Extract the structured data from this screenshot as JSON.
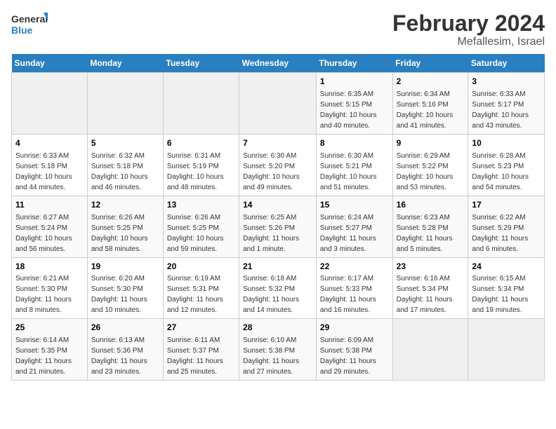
{
  "logo": {
    "line1": "General",
    "line2": "Blue"
  },
  "header": {
    "month": "February 2024",
    "location": "Mefallesim, Israel"
  },
  "days_of_week": [
    "Sunday",
    "Monday",
    "Tuesday",
    "Wednesday",
    "Thursday",
    "Friday",
    "Saturday"
  ],
  "weeks": [
    [
      {
        "day": "",
        "sunrise": "",
        "sunset": "",
        "daylight": ""
      },
      {
        "day": "",
        "sunrise": "",
        "sunset": "",
        "daylight": ""
      },
      {
        "day": "",
        "sunrise": "",
        "sunset": "",
        "daylight": ""
      },
      {
        "day": "",
        "sunrise": "",
        "sunset": "",
        "daylight": ""
      },
      {
        "day": "1",
        "sunrise": "Sunrise: 6:35 AM",
        "sunset": "Sunset: 5:15 PM",
        "daylight": "Daylight: 10 hours and 40 minutes."
      },
      {
        "day": "2",
        "sunrise": "Sunrise: 6:34 AM",
        "sunset": "Sunset: 5:16 PM",
        "daylight": "Daylight: 10 hours and 41 minutes."
      },
      {
        "day": "3",
        "sunrise": "Sunrise: 6:33 AM",
        "sunset": "Sunset: 5:17 PM",
        "daylight": "Daylight: 10 hours and 43 minutes."
      }
    ],
    [
      {
        "day": "4",
        "sunrise": "Sunrise: 6:33 AM",
        "sunset": "Sunset: 5:18 PM",
        "daylight": "Daylight: 10 hours and 44 minutes."
      },
      {
        "day": "5",
        "sunrise": "Sunrise: 6:32 AM",
        "sunset": "Sunset: 5:18 PM",
        "daylight": "Daylight: 10 hours and 46 minutes."
      },
      {
        "day": "6",
        "sunrise": "Sunrise: 6:31 AM",
        "sunset": "Sunset: 5:19 PM",
        "daylight": "Daylight: 10 hours and 48 minutes."
      },
      {
        "day": "7",
        "sunrise": "Sunrise: 6:30 AM",
        "sunset": "Sunset: 5:20 PM",
        "daylight": "Daylight: 10 hours and 49 minutes."
      },
      {
        "day": "8",
        "sunrise": "Sunrise: 6:30 AM",
        "sunset": "Sunset: 5:21 PM",
        "daylight": "Daylight: 10 hours and 51 minutes."
      },
      {
        "day": "9",
        "sunrise": "Sunrise: 6:29 AM",
        "sunset": "Sunset: 5:22 PM",
        "daylight": "Daylight: 10 hours and 53 minutes."
      },
      {
        "day": "10",
        "sunrise": "Sunrise: 6:28 AM",
        "sunset": "Sunset: 5:23 PM",
        "daylight": "Daylight: 10 hours and 54 minutes."
      }
    ],
    [
      {
        "day": "11",
        "sunrise": "Sunrise: 6:27 AM",
        "sunset": "Sunset: 5:24 PM",
        "daylight": "Daylight: 10 hours and 56 minutes."
      },
      {
        "day": "12",
        "sunrise": "Sunrise: 6:26 AM",
        "sunset": "Sunset: 5:25 PM",
        "daylight": "Daylight: 10 hours and 58 minutes."
      },
      {
        "day": "13",
        "sunrise": "Sunrise: 6:26 AM",
        "sunset": "Sunset: 5:25 PM",
        "daylight": "Daylight: 10 hours and 59 minutes."
      },
      {
        "day": "14",
        "sunrise": "Sunrise: 6:25 AM",
        "sunset": "Sunset: 5:26 PM",
        "daylight": "Daylight: 11 hours and 1 minute."
      },
      {
        "day": "15",
        "sunrise": "Sunrise: 6:24 AM",
        "sunset": "Sunset: 5:27 PM",
        "daylight": "Daylight: 11 hours and 3 minutes."
      },
      {
        "day": "16",
        "sunrise": "Sunrise: 6:23 AM",
        "sunset": "Sunset: 5:28 PM",
        "daylight": "Daylight: 11 hours and 5 minutes."
      },
      {
        "day": "17",
        "sunrise": "Sunrise: 6:22 AM",
        "sunset": "Sunset: 5:29 PM",
        "daylight": "Daylight: 11 hours and 6 minutes."
      }
    ],
    [
      {
        "day": "18",
        "sunrise": "Sunrise: 6:21 AM",
        "sunset": "Sunset: 5:30 PM",
        "daylight": "Daylight: 11 hours and 8 minutes."
      },
      {
        "day": "19",
        "sunrise": "Sunrise: 6:20 AM",
        "sunset": "Sunset: 5:30 PM",
        "daylight": "Daylight: 11 hours and 10 minutes."
      },
      {
        "day": "20",
        "sunrise": "Sunrise: 6:19 AM",
        "sunset": "Sunset: 5:31 PM",
        "daylight": "Daylight: 11 hours and 12 minutes."
      },
      {
        "day": "21",
        "sunrise": "Sunrise: 6:18 AM",
        "sunset": "Sunset: 5:32 PM",
        "daylight": "Daylight: 11 hours and 14 minutes."
      },
      {
        "day": "22",
        "sunrise": "Sunrise: 6:17 AM",
        "sunset": "Sunset: 5:33 PM",
        "daylight": "Daylight: 11 hours and 16 minutes."
      },
      {
        "day": "23",
        "sunrise": "Sunrise: 6:16 AM",
        "sunset": "Sunset: 5:34 PM",
        "daylight": "Daylight: 11 hours and 17 minutes."
      },
      {
        "day": "24",
        "sunrise": "Sunrise: 6:15 AM",
        "sunset": "Sunset: 5:34 PM",
        "daylight": "Daylight: 11 hours and 19 minutes."
      }
    ],
    [
      {
        "day": "25",
        "sunrise": "Sunrise: 6:14 AM",
        "sunset": "Sunset: 5:35 PM",
        "daylight": "Daylight: 11 hours and 21 minutes."
      },
      {
        "day": "26",
        "sunrise": "Sunrise: 6:13 AM",
        "sunset": "Sunset: 5:36 PM",
        "daylight": "Daylight: 11 hours and 23 minutes."
      },
      {
        "day": "27",
        "sunrise": "Sunrise: 6:11 AM",
        "sunset": "Sunset: 5:37 PM",
        "daylight": "Daylight: 11 hours and 25 minutes."
      },
      {
        "day": "28",
        "sunrise": "Sunrise: 6:10 AM",
        "sunset": "Sunset: 5:38 PM",
        "daylight": "Daylight: 11 hours and 27 minutes."
      },
      {
        "day": "29",
        "sunrise": "Sunrise: 6:09 AM",
        "sunset": "Sunset: 5:38 PM",
        "daylight": "Daylight: 11 hours and 29 minutes."
      },
      {
        "day": "",
        "sunrise": "",
        "sunset": "",
        "daylight": ""
      },
      {
        "day": "",
        "sunrise": "",
        "sunset": "",
        "daylight": ""
      }
    ]
  ]
}
